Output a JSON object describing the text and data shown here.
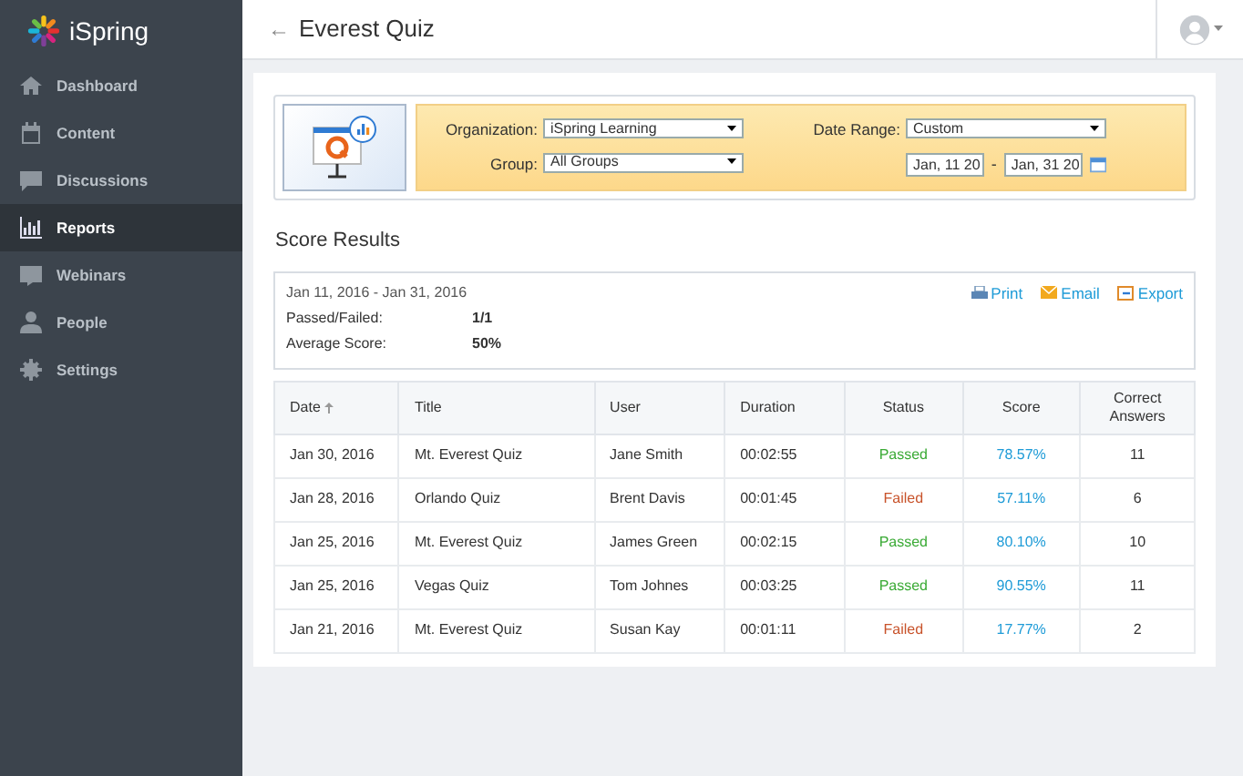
{
  "logo": "iSpring",
  "sidebar": {
    "items": [
      {
        "label": "Dashboard",
        "selected": false
      },
      {
        "label": "Content",
        "selected": false
      },
      {
        "label": "Discussions",
        "selected": false
      },
      {
        "label": "Reports",
        "selected": true
      },
      {
        "label": "Webinars",
        "selected": false
      },
      {
        "label": "People",
        "selected": false
      },
      {
        "label": "Settings",
        "selected": false
      }
    ]
  },
  "header": {
    "back": "←",
    "title": "Everest Quiz"
  },
  "filters": {
    "organization_label": "Organization:",
    "organization": "iSpring Learning",
    "group_label": "Group:",
    "group": "All Groups",
    "date_range_label": "Date Range:",
    "date_range": "Custom",
    "date_from": "Jan, 11 20",
    "date_separator": "-",
    "date_to": "Jan, 31 20"
  },
  "section_title": "Score Results",
  "summary": {
    "period": "Jan 11, 2016 - Jan 31, 2016",
    "passed_failed_label": "Passed/Failed:",
    "passed_failed": "1/1",
    "average_label": "Average Score:",
    "average": "50%",
    "actions": [
      "Print",
      "Email",
      "Export"
    ]
  },
  "table": {
    "columns": [
      "Date",
      "Title",
      "User",
      "Duration",
      "Status",
      "Score",
      "Correct Answers"
    ],
    "rows": [
      {
        "date": "Jan 30, 2016",
        "title": "Mt. Everest Quiz",
        "user": "Jane Smith",
        "duration": "00:02:55",
        "status": "Passed",
        "kind": "passed",
        "score": "78.57%",
        "correct": "11"
      },
      {
        "date": "Jan 28, 2016",
        "title": "Orlando Quiz",
        "user": "Brent Davis",
        "duration": "00:01:45",
        "status": "Failed",
        "kind": "failed",
        "score": "57.11%",
        "correct": "6"
      },
      {
        "date": "Jan 25, 2016",
        "title": "Mt. Everest Quiz",
        "user": "James Green",
        "duration": "00:02:15",
        "status": "Passed",
        "kind": "passed",
        "score": "80.10%",
        "correct": "10"
      },
      {
        "date": "Jan 25, 2016",
        "title": "Vegas Quiz",
        "user": "Tom Johnes",
        "duration": "00:03:25",
        "status": "Passed",
        "kind": "passed",
        "score": "90.55%",
        "correct": "11"
      },
      {
        "date": "Jan 21, 2016",
        "title": "Mt. Everest Quiz",
        "user": "Susan Kay",
        "duration": "00:01:11",
        "status": "Failed",
        "kind": "failed",
        "score": "17.77%",
        "correct": "2"
      }
    ]
  }
}
